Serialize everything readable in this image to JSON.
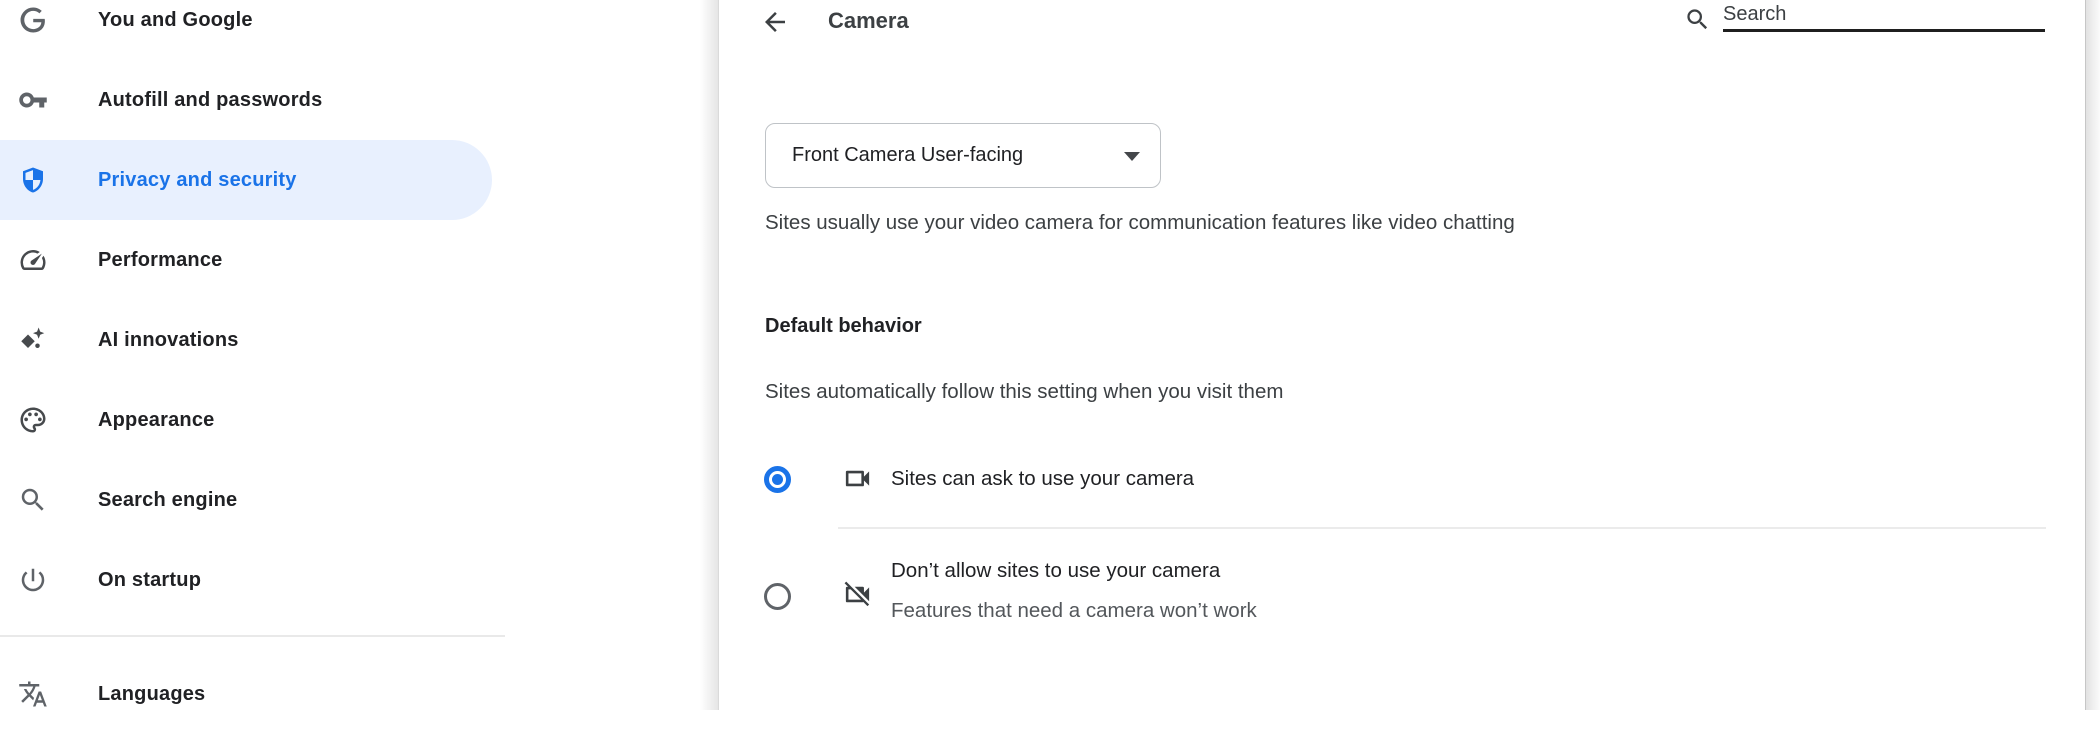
{
  "sidebar": {
    "items": [
      {
        "label": "You and Google",
        "icon": "google-g-icon",
        "selected": false
      },
      {
        "label": "Autofill and passwords",
        "icon": "key-icon",
        "selected": false
      },
      {
        "label": "Privacy and security",
        "icon": "shield-icon",
        "selected": true
      },
      {
        "label": "Performance",
        "icon": "speedometer-icon",
        "selected": false
      },
      {
        "label": "AI innovations",
        "icon": "sparkles-icon",
        "selected": false
      },
      {
        "label": "Appearance",
        "icon": "palette-icon",
        "selected": false
      },
      {
        "label": "Search engine",
        "icon": "magnifier-icon",
        "selected": false
      },
      {
        "label": "On startup",
        "icon": "power-icon",
        "selected": false
      },
      {
        "label": "Languages",
        "icon": "translate-icon",
        "selected": false
      }
    ],
    "selected_text_color": "#1a73e8",
    "selected_bg_color": "#e8f0fe"
  },
  "header": {
    "title": "Camera"
  },
  "search": {
    "placeholder": "Search"
  },
  "camera_section": {
    "device_select": {
      "value": "Front Camera User-facing"
    },
    "description": "Sites usually use your video camera for communication features like video chatting"
  },
  "default_behavior": {
    "heading": "Default behavior",
    "subheading": "Sites automatically follow this setting when you visit them",
    "options": [
      {
        "label": "Sites can ask to use your camera",
        "selected": true
      },
      {
        "label": "Don’t allow sites to use your camera",
        "sublabel": "Features that need a camera won’t work",
        "selected": false
      }
    ]
  },
  "colors": {
    "accent_blue": "#1a73e8",
    "selected_pill_bg": "#e8f0fe"
  }
}
